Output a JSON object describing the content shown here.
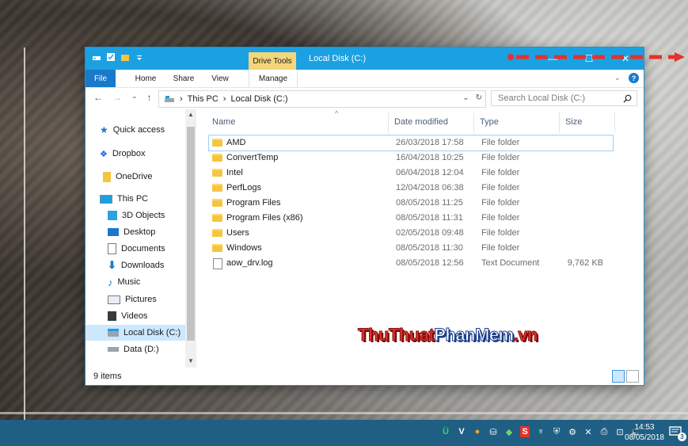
{
  "window": {
    "title": "Local Disk (C:)",
    "contextual_tab": "Drive Tools",
    "buttons": {
      "minimize": "—",
      "maximize": "☐",
      "close": "✕"
    }
  },
  "ribbon": {
    "tabs": [
      "File",
      "Home",
      "Share",
      "View",
      "Manage"
    ]
  },
  "address": {
    "crumbs": [
      "This PC",
      "Local Disk (C:)"
    ],
    "search_placeholder": "Search Local Disk (C:)"
  },
  "nav_pane": {
    "items": [
      {
        "label": "Quick access",
        "icon": "star-icon"
      },
      {
        "label": "Dropbox",
        "icon": "dropbox-icon"
      },
      {
        "label": "OneDrive",
        "icon": "folder-icon"
      },
      {
        "label": "This PC",
        "icon": "computer-icon"
      },
      {
        "label": "3D Objects",
        "icon": "cube-icon"
      },
      {
        "label": "Desktop",
        "icon": "desktop-icon"
      },
      {
        "label": "Documents",
        "icon": "document-icon"
      },
      {
        "label": "Downloads",
        "icon": "download-icon"
      },
      {
        "label": "Music",
        "icon": "music-icon"
      },
      {
        "label": "Pictures",
        "icon": "pictures-icon"
      },
      {
        "label": "Videos",
        "icon": "video-icon"
      },
      {
        "label": "Local Disk (C:)",
        "icon": "drive-icon",
        "selected": true
      },
      {
        "label": "Data (D:)",
        "icon": "drive-icon"
      }
    ]
  },
  "columns": {
    "name": "Name",
    "date": "Date modified",
    "type": "Type",
    "size": "Size"
  },
  "files": [
    {
      "name": "AMD",
      "date": "26/03/2018 17:58",
      "type": "File folder",
      "size": "",
      "kind": "folder"
    },
    {
      "name": "ConvertTemp",
      "date": "16/04/2018 10:25",
      "type": "File folder",
      "size": "",
      "kind": "folder"
    },
    {
      "name": "Intel",
      "date": "06/04/2018 12:04",
      "type": "File folder",
      "size": "",
      "kind": "folder"
    },
    {
      "name": "PerfLogs",
      "date": "12/04/2018 06:38",
      "type": "File folder",
      "size": "",
      "kind": "folder"
    },
    {
      "name": "Program Files",
      "date": "08/05/2018 11:25",
      "type": "File folder",
      "size": "",
      "kind": "folder"
    },
    {
      "name": "Program Files (x86)",
      "date": "08/05/2018 11:31",
      "type": "File folder",
      "size": "",
      "kind": "folder"
    },
    {
      "name": "Users",
      "date": "02/05/2018 09:48",
      "type": "File folder",
      "size": "",
      "kind": "folder"
    },
    {
      "name": "Windows",
      "date": "08/05/2018 11:30",
      "type": "File folder",
      "size": "",
      "kind": "folder"
    },
    {
      "name": "aow_drv.log",
      "date": "08/05/2018 12:56",
      "type": "Text Document",
      "size": "9,762 KB",
      "kind": "file"
    }
  ],
  "status": {
    "items_count": "9 items"
  },
  "watermark": {
    "part1": "ThuThuat",
    "part2": "PhanMem",
    "part3": ".vn"
  },
  "taskbar": {
    "time": "14:53",
    "date": "08/05/2018",
    "notification_count": "3"
  },
  "colors": {
    "titlebar": "#1ba1e2",
    "file_tab": "#1979ca",
    "drive_tools": "#f3d67a",
    "arrow": "#e5322b",
    "taskbar": "#1f5f84"
  }
}
